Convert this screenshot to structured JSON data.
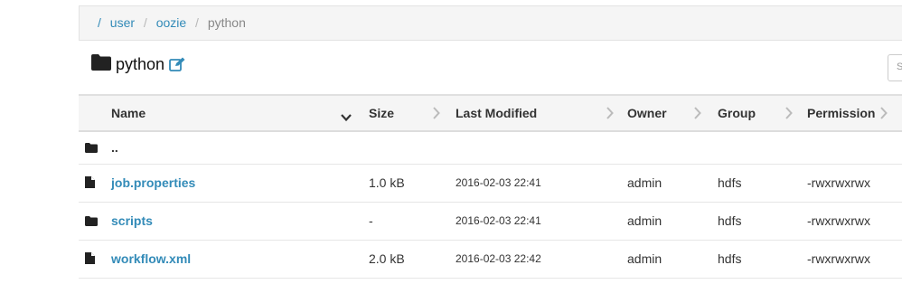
{
  "breadcrumb": {
    "root_sep": "/",
    "items": [
      "user",
      "oozie"
    ],
    "current": "python"
  },
  "title": "python",
  "search": {
    "placeholder": "Search"
  },
  "table": {
    "headers": [
      "Name",
      "Size",
      "Last Modified",
      "Owner",
      "Group",
      "Permission"
    ],
    "parent_label": "..",
    "rows": [
      {
        "type": "file",
        "name": "job.properties",
        "size": "1.0 kB",
        "modified": "2016-02-03 22:41",
        "owner": "admin",
        "group": "hdfs",
        "perm": "-rwxrwxrwx"
      },
      {
        "type": "folder",
        "name": "scripts",
        "size": "-",
        "modified": "2016-02-03 22:41",
        "owner": "admin",
        "group": "hdfs",
        "perm": "-rwxrwxrwx"
      },
      {
        "type": "file",
        "name": "workflow.xml",
        "size": "2.0 kB",
        "modified": "2016-02-03 22:42",
        "owner": "admin",
        "group": "hdfs",
        "perm": "-rwxrwxrwx"
      }
    ]
  },
  "colors": {
    "link": "#338bb8",
    "header_bg": "#f5f5f5"
  }
}
